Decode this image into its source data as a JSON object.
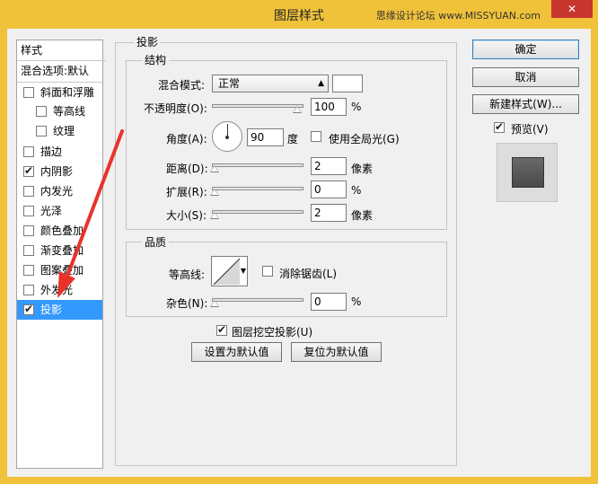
{
  "window": {
    "title": "图层样式",
    "watermark": "思缘设计论坛 www.MISSYUAN.com",
    "close_glyph": "✕"
  },
  "left_panel": {
    "header": "样式",
    "blend_options": "混合选项:默认",
    "items": [
      {
        "label": "斜面和浮雕",
        "checked": false
      },
      {
        "label": "等高线",
        "checked": false
      },
      {
        "label": "纹理",
        "checked": false
      },
      {
        "label": "描边",
        "checked": false
      },
      {
        "label": "内阴影",
        "checked": true
      },
      {
        "label": "内发光",
        "checked": false
      },
      {
        "label": "光泽",
        "checked": false
      },
      {
        "label": "颜色叠加",
        "checked": false
      },
      {
        "label": "渐变叠加",
        "checked": false
      },
      {
        "label": "图案叠加",
        "checked": false
      },
      {
        "label": "外发光",
        "checked": false
      },
      {
        "label": "投影",
        "checked": true,
        "selected": true
      }
    ]
  },
  "drop_shadow": {
    "section_title": "投影",
    "structure": {
      "title": "结构",
      "blend_mode_label": "混合模式:",
      "blend_mode_value": "正常",
      "blend_color": "#ffffff",
      "opacity_label": "不透明度(O):",
      "opacity_value": "100",
      "opacity_unit": "%",
      "opacity_fraction": 1.0,
      "angle_label": "角度(A):",
      "angle_value": "90",
      "angle_unit": "度",
      "global_light_label": "使用全局光(G)",
      "global_light_checked": false,
      "distance_label": "距离(D):",
      "distance_value": "2",
      "distance_unit": "像素",
      "distance_fraction": 0.0,
      "spread_label": "扩展(R):",
      "spread_value": "0",
      "spread_unit": "%",
      "spread_fraction": 0.0,
      "size_label": "大小(S):",
      "size_value": "2",
      "size_unit": "像素",
      "size_fraction": 0.0
    },
    "quality": {
      "title": "品质",
      "contour_label": "等高线:",
      "anti_alias_label": "消除锯齿(L)",
      "anti_alias_checked": false,
      "noise_label": "杂色(N):",
      "noise_value": "0",
      "noise_unit": "%",
      "noise_fraction": 0.0
    },
    "knockout_label": "图层挖空投影(U)",
    "knockout_checked": true,
    "make_default": "设置为默认值",
    "reset_default": "复位为默认值"
  },
  "right_panel": {
    "ok": "确定",
    "cancel": "取消",
    "new_style": "新建样式(W)...",
    "preview_label": "预览(V)",
    "preview_checked": true
  },
  "colors": {
    "window_frame": "#f0c23a",
    "selection": "#3399ff",
    "annotation_arrow": "#e8332a"
  }
}
